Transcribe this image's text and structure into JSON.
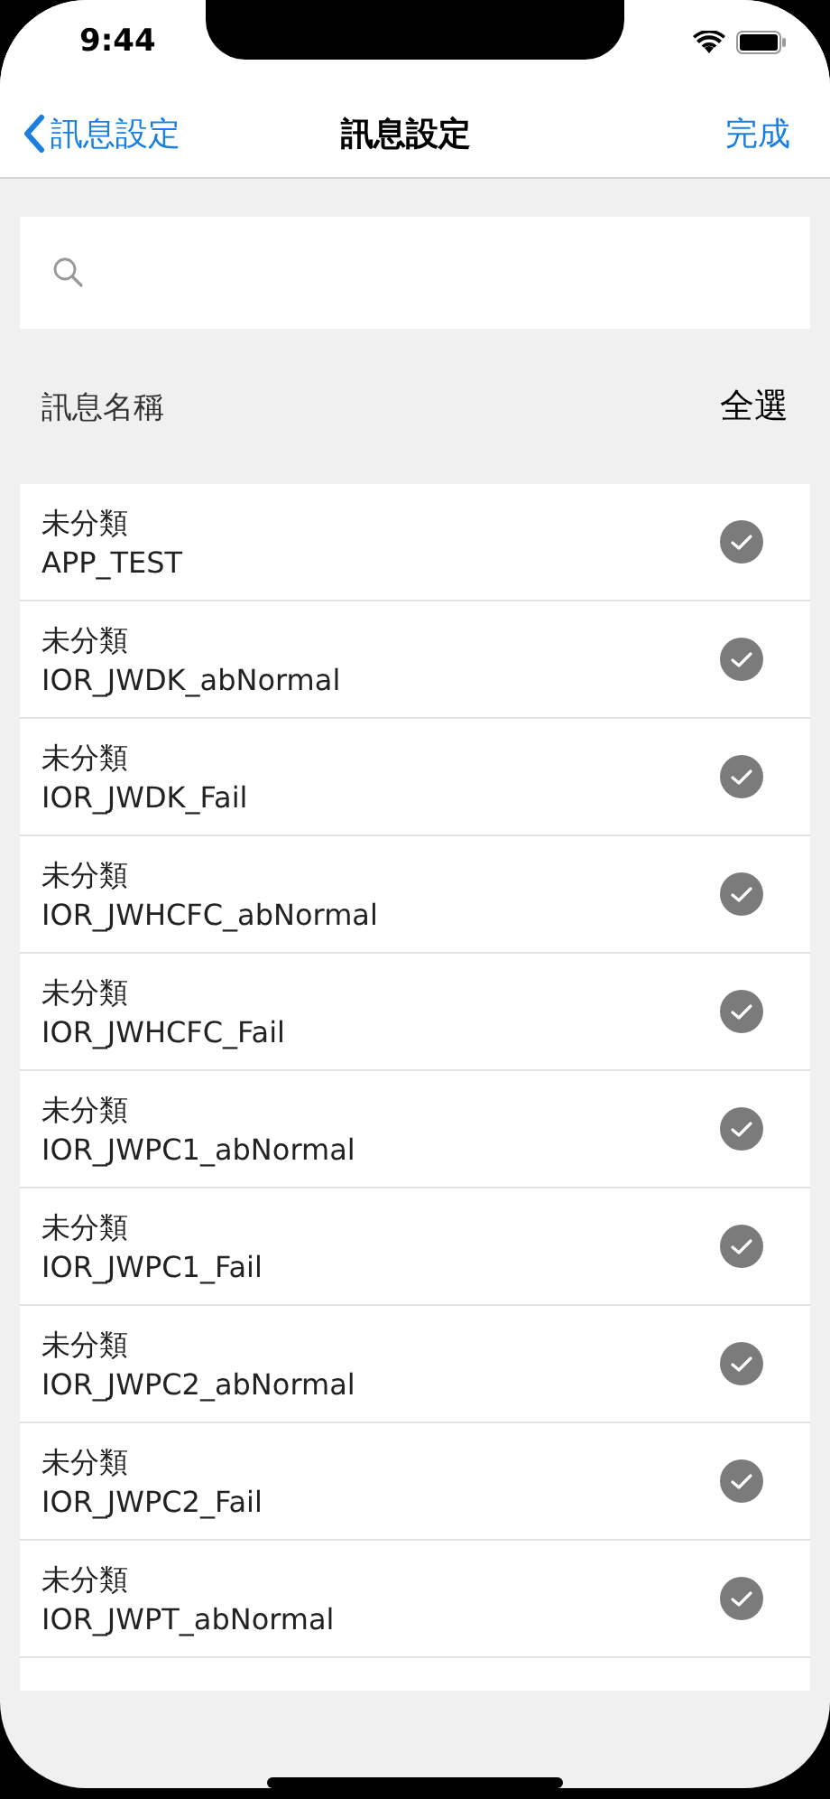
{
  "status_bar": {
    "time": "9:44"
  },
  "nav": {
    "back": "訊息設定",
    "title": "訊息設定",
    "done": "完成"
  },
  "header": {
    "label": "訊息名稱",
    "select_all": "全選"
  },
  "items": [
    {
      "category": "未分類",
      "name": "APP_TEST",
      "checked": true
    },
    {
      "category": "未分類",
      "name": "IOR_JWDK_abNormal",
      "checked": true
    },
    {
      "category": "未分類",
      "name": "IOR_JWDK_Fail",
      "checked": true
    },
    {
      "category": "未分類",
      "name": "IOR_JWHCFC_abNormal",
      "checked": true
    },
    {
      "category": "未分類",
      "name": "IOR_JWHCFC_Fail",
      "checked": true
    },
    {
      "category": "未分類",
      "name": "IOR_JWPC1_abNormal",
      "checked": true
    },
    {
      "category": "未分類",
      "name": "IOR_JWPC1_Fail",
      "checked": true
    },
    {
      "category": "未分類",
      "name": "IOR_JWPC2_abNormal",
      "checked": true
    },
    {
      "category": "未分類",
      "name": "IOR_JWPC2_Fail",
      "checked": true
    },
    {
      "category": "未分類",
      "name": "IOR_JWPT_abNormal",
      "checked": true
    }
  ]
}
